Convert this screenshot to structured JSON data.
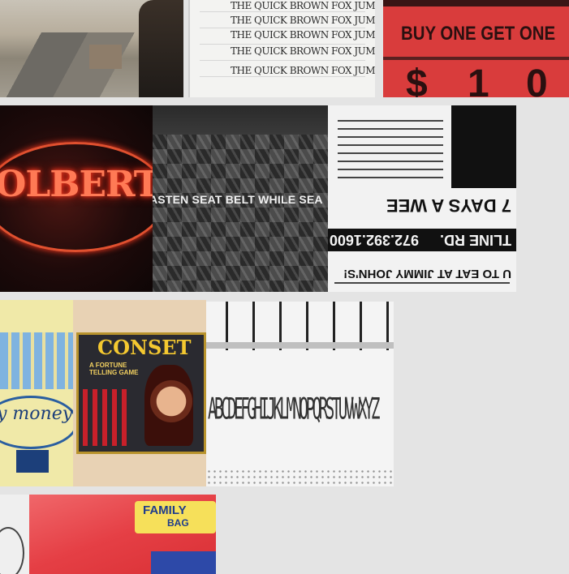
{
  "tiles": {
    "handwriting": {
      "lines": [
        "THE QUICK BROWN FOX JUMPED OVER",
        "THE QUICK BROWN FOX JUMPED OVER",
        "THE QUICK BROWN FOX JUMPED OVER",
        "THE QUICK BROWN FOX JUMPED",
        "THE QUICK BROWN FOX JUMPED"
      ]
    },
    "sign": {
      "text": "BUY ONE GET ONE",
      "price": [
        "$",
        "1",
        "0"
      ]
    },
    "neon": {
      "text": "OLBERT'S"
    },
    "seatbelt": {
      "text": "ASTEN SEAT BELT WHILE SEA"
    },
    "newspaper": {
      "headline": "7 DAYS A WEE",
      "phone": "972.392.1600",
      "road": "TLINE RD.",
      "slogan": "U TO EAT AT JIMMY JOHN'S!"
    },
    "money": {
      "text": "y money"
    },
    "conset": {
      "title": "CONSET",
      "subtitle": "A FORTUNE TELLING GAME"
    },
    "alphabet": {
      "text": "ABCDEFGHIJKLMNOPQRSTUVWXYZ"
    },
    "familybag": {
      "line1": "FAMILY",
      "line2": "BAG"
    }
  }
}
